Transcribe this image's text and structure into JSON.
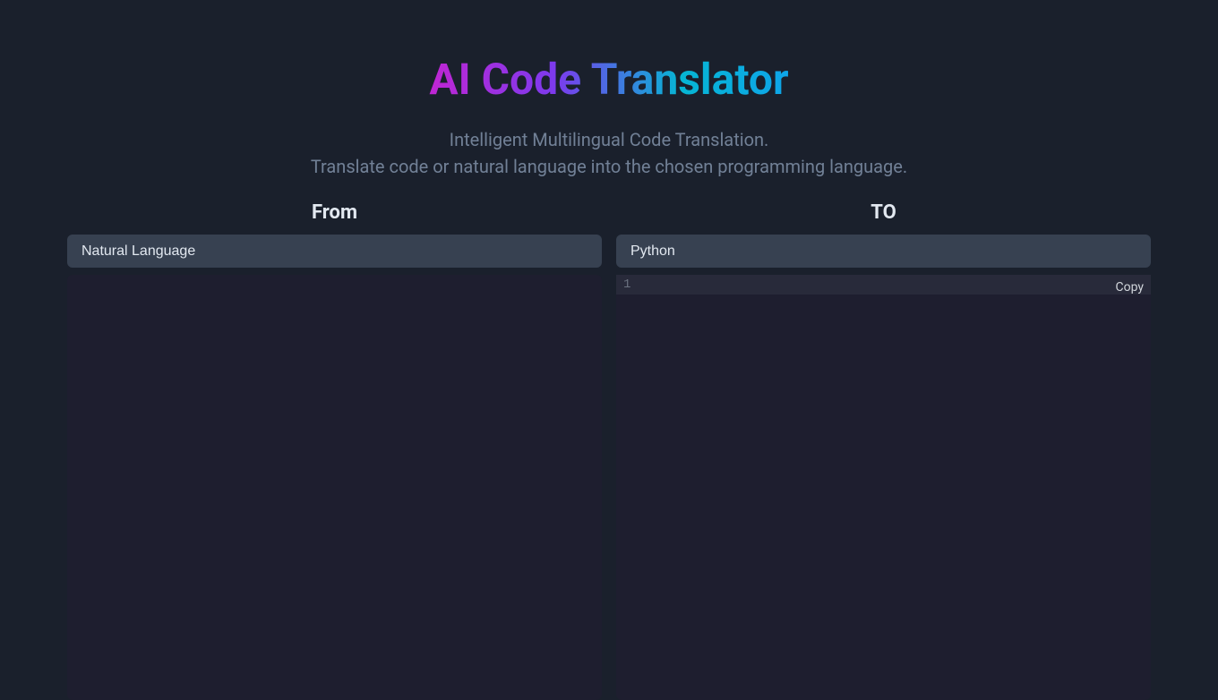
{
  "header": {
    "title": "AI Code Translator",
    "subtitle_line1": "Intelligent Multilingual Code Translation.",
    "subtitle_line2": "Translate code or natural language into the chosen programming language."
  },
  "from_panel": {
    "label": "From",
    "selected_language": "Natural Language",
    "content": ""
  },
  "to_panel": {
    "label": "TO",
    "selected_language": "Python",
    "content": "",
    "line_number": "1",
    "copy_button": "Copy"
  }
}
